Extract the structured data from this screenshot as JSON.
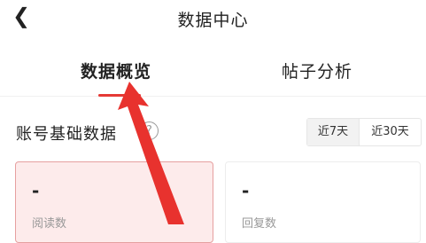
{
  "header": {
    "back_icon": "chevron-left-icon",
    "title": "数据中心"
  },
  "tabs": [
    {
      "label": "数据概览",
      "active": true
    },
    {
      "label": "帖子分析",
      "active": false
    }
  ],
  "section": {
    "title": "账号基础数据",
    "help_glyph": "?",
    "range_options": [
      {
        "label": "近7天",
        "active": true
      },
      {
        "label": "近30天",
        "active": false
      }
    ]
  },
  "cards": [
    {
      "value": "-",
      "label": "阅读数"
    },
    {
      "value": "-",
      "label": "回复数"
    }
  ],
  "colors": {
    "accent": "#e53935",
    "annotation_arrow": "#e8322e",
    "card_highlight": "#fdebeb"
  }
}
